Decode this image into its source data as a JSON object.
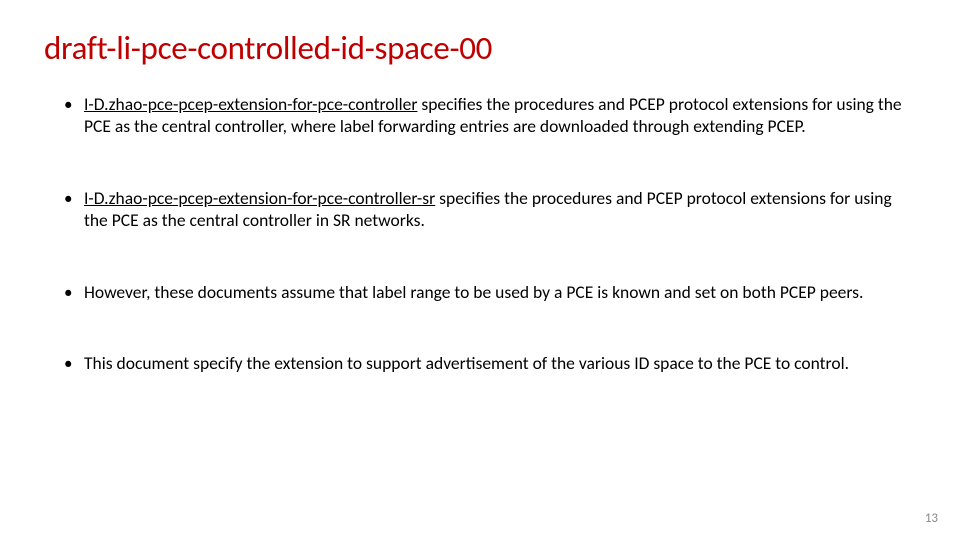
{
  "title": "draft-li-pce-controlled-id-space-00",
  "bullets": [
    {
      "link": "I-D.zhao-pce-pcep-extension-for-pce-controller",
      "text": "  specifies the procedures and PCEP protocol extensions for using the PCE as the central controller, where label forwarding entries are downloaded through extending PCEP."
    },
    {
      "link": "I-D.zhao-pce-pcep-extension-for-pce-controller-sr",
      "text": " specifies the procedures and PCEP protocol extensions for using the PCE as the central controller in SR networks."
    },
    {
      "link": "",
      "text": "However, these documents assume that label range to be used by a PCE is known and set on both PCEP peers."
    },
    {
      "link": "",
      "text": "This document specify the extension to support advertisement of the various ID space to the PCE to control."
    }
  ],
  "pageNumber": "13"
}
